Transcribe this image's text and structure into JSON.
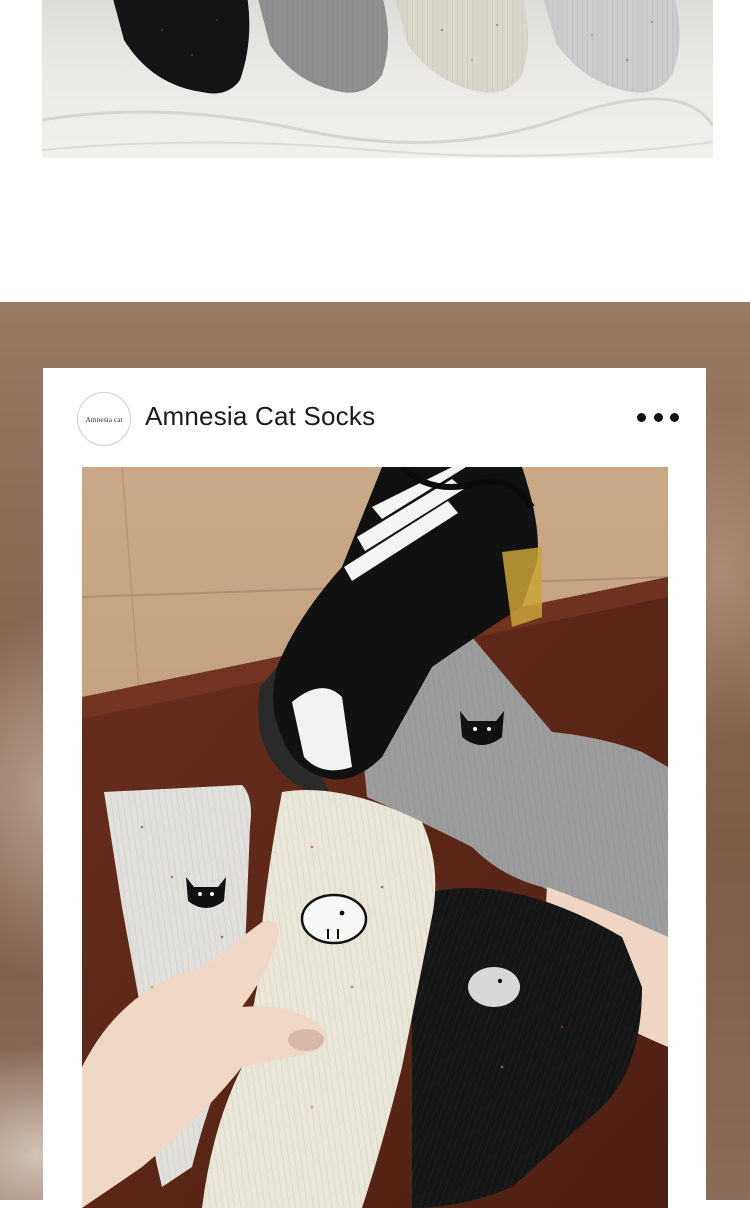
{
  "top_image": {
    "alt": ""
  },
  "post": {
    "avatar_text": "Amnesia cat",
    "account_name": "Amnesia Cat Socks",
    "more_icon": "more-horizontal-icon",
    "image_alt": ""
  }
}
